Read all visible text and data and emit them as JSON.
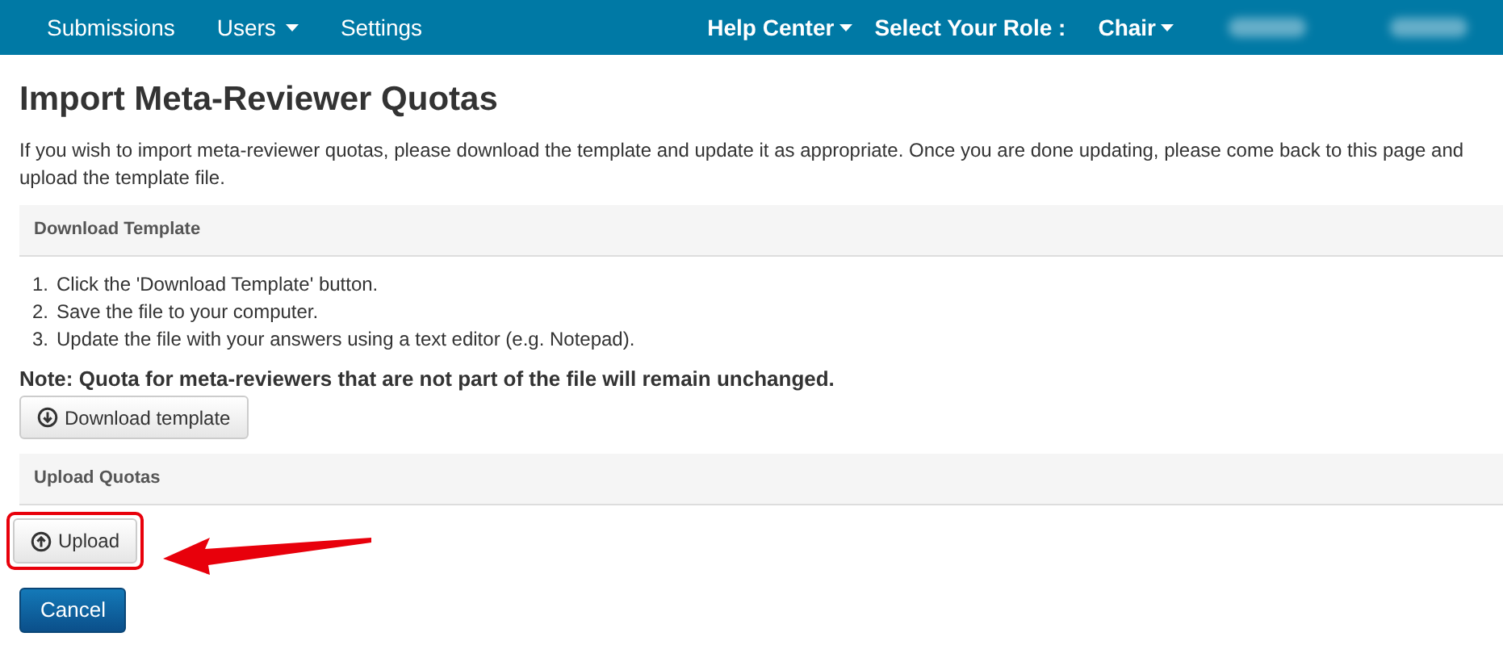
{
  "navbar": {
    "left_items": [
      {
        "label": "Submissions",
        "dropdown": false
      },
      {
        "label": "Users",
        "dropdown": true
      },
      {
        "label": "Settings",
        "dropdown": false
      }
    ],
    "right_items": [
      {
        "label": "Help Center",
        "dropdown": true,
        "kind": "link"
      },
      {
        "label": "Select Your Role :",
        "dropdown": false,
        "kind": "label"
      },
      {
        "label": "Chair",
        "dropdown": true,
        "kind": "link"
      }
    ]
  },
  "title": "Import Meta-Reviewer Quotas",
  "intro": "If you wish to import meta-reviewer quotas, please download the template and update it as appropriate. Once you are done updating, please come back to this page and upload the template file.",
  "download_panel": {
    "heading": "Download Template",
    "steps": [
      {
        "number": "1.",
        "text": "Click the 'Download Template' button."
      },
      {
        "number": "2.",
        "text": "Save the file to your computer."
      },
      {
        "number": "3.",
        "text": "Update the file with your answers using a text editor (e.g. Notepad)."
      }
    ],
    "note": "Note: Quota for meta-reviewers that are not part of the file will remain unchanged.",
    "button": "Download template"
  },
  "upload_panel": {
    "heading": "Upload Quotas",
    "button": "Upload"
  },
  "cancel_button": "Cancel"
}
